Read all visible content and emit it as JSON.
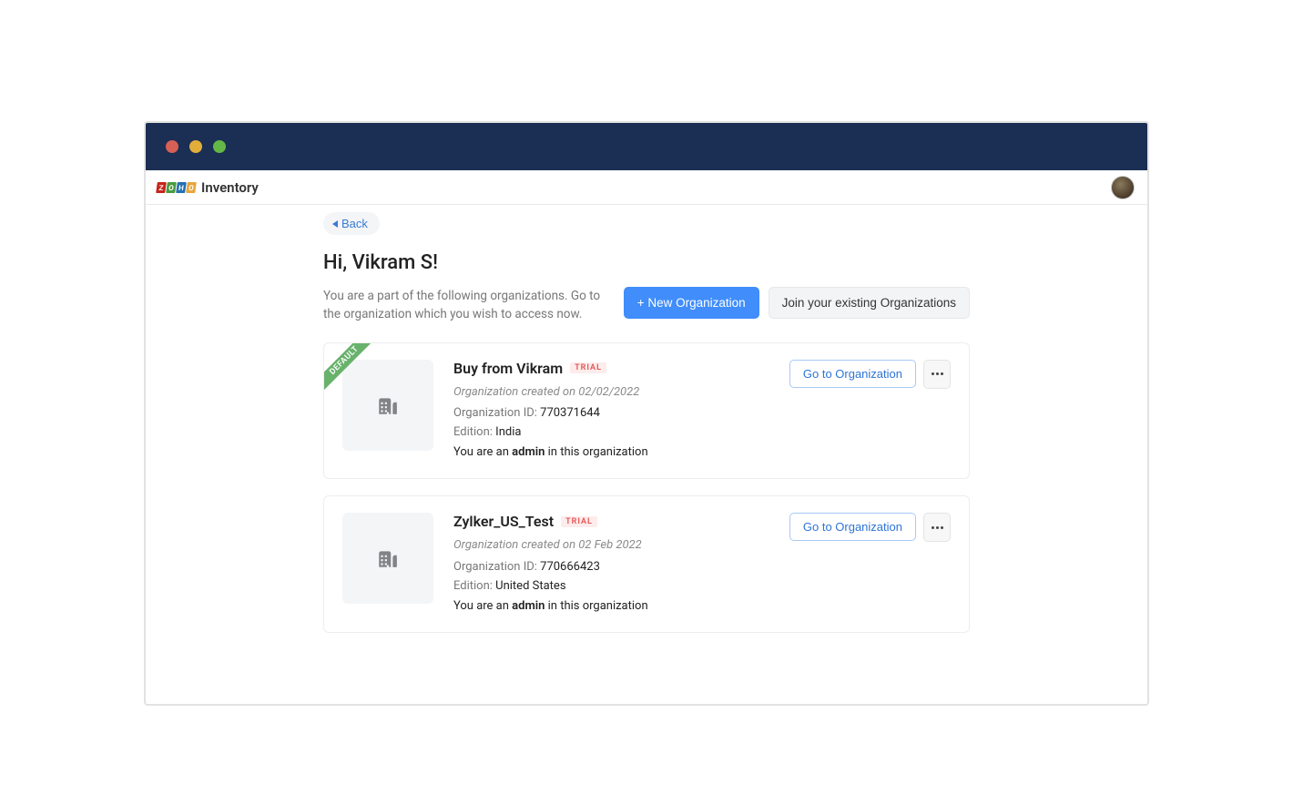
{
  "brand": {
    "name": "Inventory",
    "logo_tiles": [
      "Z",
      "O",
      "H",
      "O"
    ]
  },
  "nav": {
    "back_label": "Back"
  },
  "greeting": "Hi, Vikram S!",
  "intro": "You are a part of the following organizations. Go to the organization which you wish to access now.",
  "actions": {
    "new_org": "+ New Organization",
    "join_existing": "Join your existing Organizations"
  },
  "labels": {
    "default_ribbon": "DEFAULT",
    "trial_badge": "TRIAL",
    "org_id_label": "Organization ID:",
    "edition_label": "Edition:",
    "role_prefix": "You are an",
    "role_suffix": "in this organization",
    "go_button": "Go to Organization"
  },
  "organizations": [
    {
      "name": "Buy from Vikram",
      "is_default": true,
      "trial": true,
      "created_text": "Organization created on 02/02/2022",
      "org_id": "770371644",
      "edition": "India",
      "role": "admin"
    },
    {
      "name": "Zylker_US_Test",
      "is_default": false,
      "trial": true,
      "created_text": "Organization created on 02 Feb 2022",
      "org_id": "770666423",
      "edition": "United States",
      "role": "admin"
    }
  ]
}
